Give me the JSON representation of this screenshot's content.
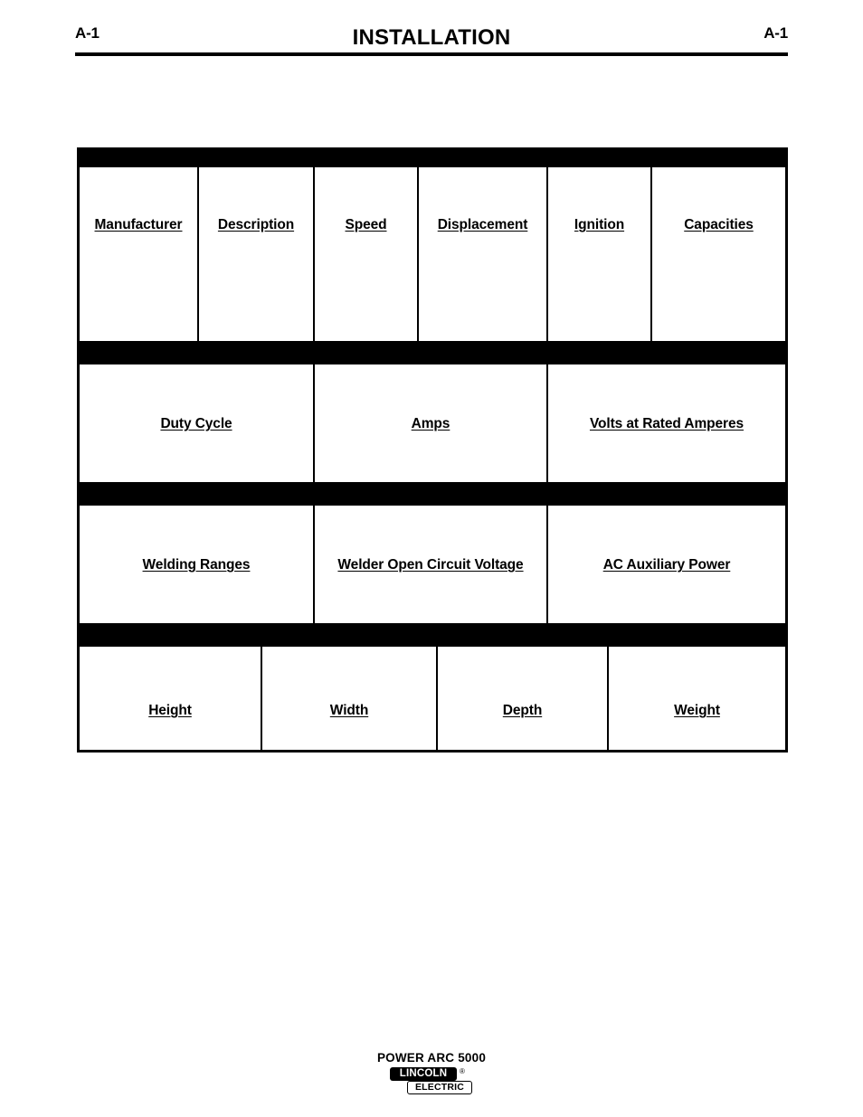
{
  "page": {
    "header_left": "A-1",
    "header_title": "INSTALLATION",
    "header_right": "A-1"
  },
  "spec_tables": [
    {
      "id": "engine-specifications",
      "bar_caption": "",
      "columns": [
        {
          "label": "Manufacturer",
          "value": ""
        },
        {
          "label": "Description",
          "value": ""
        },
        {
          "label": "Speed",
          "value": ""
        },
        {
          "label": "Displacement",
          "value": ""
        },
        {
          "label": "Ignition",
          "value": ""
        },
        {
          "label": "Capacities ",
          "value": ""
        }
      ]
    },
    {
      "id": "rated-output",
      "bar_caption": "",
      "columns": [
        {
          "label": "Duty Cycle",
          "value": ""
        },
        {
          "label": "Amps",
          "value": ""
        },
        {
          "label": "Volts at Rated Amperes",
          "value": ""
        }
      ]
    },
    {
      "id": "output-ranges",
      "bar_caption": "",
      "columns": [
        {
          "label": "Welding Ranges",
          "value": ""
        },
        {
          "label": "Welder Open Circuit Voltage",
          "value": ""
        },
        {
          "label": "AC Auxiliary Power",
          "value": ""
        }
      ]
    },
    {
      "id": "physical-dimensions",
      "bar_caption": "",
      "columns": [
        {
          "label": "Height",
          "value": ""
        },
        {
          "label": "Width",
          "value": ""
        },
        {
          "label": "Depth",
          "value": ""
        },
        {
          "label": " Weight",
          "value": ""
        }
      ]
    }
  ],
  "footer": {
    "model": "POWER ARC 5000",
    "logo_top": "LINCOLN",
    "logo_reg": "®",
    "logo_bottom": "ELECTRIC"
  },
  "colors": {
    "ink": "#000000",
    "paper": "#ffffff"
  }
}
